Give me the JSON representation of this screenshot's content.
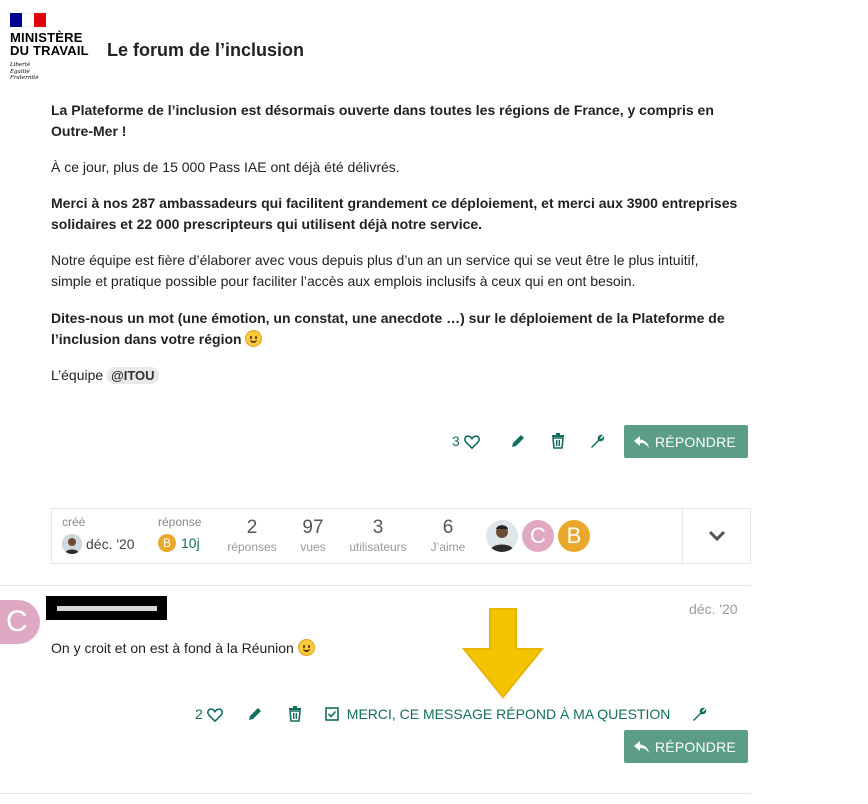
{
  "header": {
    "logo_line1": "MINISTÈRE",
    "logo_line2": "DU TRAVAIL",
    "devise1": "Liberté",
    "devise2": "Égalité",
    "devise3": "Fraternité",
    "forum_title": "Le forum de l’inclusion",
    "flag_colors": [
      "#000091",
      "#ffffff",
      "#e1000f"
    ]
  },
  "post1": {
    "p1": "La Plateforme de l’inclusion est désormais ouverte dans toutes les régions de France, y compris en Outre-Mer !",
    "p2": "À ce jour, plus de 15 000 Pass IAE ont déjà été délivrés.",
    "p3": "Merci à nos 287 ambassadeurs qui facilitent grandement ce déploiement, et merci aux 3900 entreprises solidaires et 22 000 prescripteurs qui utilisent déjà notre service.",
    "p4": "Notre équipe est fière d’élaborer avec vous depuis plus d’un an un service qui se veut être le plus intuitif, simple et pratique possible pour faciliter l’accès aux emplois inclusifs à ceux qui en ont besoin.",
    "p5": "Dites-nous un mot (une émotion, un constat, une anecdote …) sur le déploiement de la Plateforme de l’inclusion dans votre région",
    "p6_prefix": "L’équipe",
    "mention": "@ITOU",
    "likes": "3",
    "reply_label": "RÉPONDRE"
  },
  "summary": {
    "created_label": "créé",
    "created_date": "déc. '20",
    "reply_label": "réponse",
    "reply_date": "10j",
    "reply_avatar_letter": "B",
    "stats": [
      {
        "num": "2",
        "label": "réponses"
      },
      {
        "num": "97",
        "label": "vues"
      },
      {
        "num": "3",
        "label": "utilisateurs"
      },
      {
        "num": "6",
        "label": "J’aime"
      }
    ],
    "participants": [
      "C",
      "B"
    ],
    "colors": {
      "c_avatar": "#e0a9c3",
      "b_avatar": "#e9a72b"
    }
  },
  "post2": {
    "avatar_letter": "C",
    "date": "déc. '20",
    "text": "On y croit et on est à fond à la Réunion",
    "likes": "2",
    "solution_label": "MERCI, CE MESSAGE RÉPOND À MA QUESTION",
    "reply_label": "RÉPONDRE"
  },
  "colors": {
    "accent": "#136d5e",
    "button": "#5c9d85",
    "arrow": "#f5c400"
  }
}
